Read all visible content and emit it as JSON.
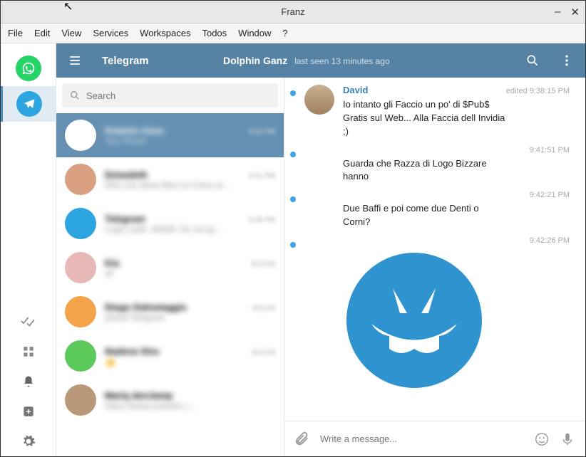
{
  "window": {
    "title": "Franz"
  },
  "menubar": [
    "File",
    "Edit",
    "View",
    "Services",
    "Workspaces",
    "Todos",
    "Window",
    "?"
  ],
  "franz_services": [
    {
      "name": "whatsapp",
      "active": false,
      "color": "#25d366"
    },
    {
      "name": "telegram",
      "active": true,
      "color": "#2ca5e0"
    }
  ],
  "telegram": {
    "brand": "Telegram",
    "peer": {
      "name": "Dolphin Ganz",
      "status": "last seen 13 minutes ago"
    },
    "search_placeholder": "Search",
    "chats": [
      {
        "name": "Dolphin Ganz",
        "preview": "You: Photo",
        "time": "9:42 PM",
        "active": true,
        "avatar_bg": "#ffffff"
      },
      {
        "name": "Dziwaleth",
        "preview": "Mira che disse Bisu la Crima st...",
        "time": "9:41 PM",
        "active": false,
        "avatar_bg": "#d8a080"
      },
      {
        "name": "Telegram",
        "preview": "Login code: 40438. Do not gi...",
        "time": "6:28 PM",
        "active": false,
        "avatar_bg": "#2ca5e0"
      },
      {
        "name": "Kia",
        "preview": "ok",
        "time": "5/12/19",
        "active": false,
        "avatar_bg": "#e8b8b8"
      },
      {
        "name": "Diego Dalnotaggio",
        "preview": "joined Telegram",
        "time": "4/11/19",
        "active": false,
        "avatar_bg": "#f5a34a"
      },
      {
        "name": "Nadene Dira",
        "preview": "👍",
        "time": "3/12/19",
        "active": false,
        "avatar_bg": "#5cc95c"
      },
      {
        "name": "Mariq denJamp",
        "preview": "https://www.youtube.c...",
        "time": "",
        "active": false,
        "avatar_bg": "#b89878"
      }
    ],
    "messages": [
      {
        "sender": "David",
        "avatar": true,
        "text": "Io intanto gli Faccio un po' di $Pub$ Gratis sul Web... Alla Faccia dell Invidia ;)",
        "time": "9:38:15 PM",
        "edited": true,
        "dot": true
      },
      {
        "sender": "",
        "avatar": false,
        "text": "Guarda che Razza di Logo Bizzare hanno",
        "time": "9:41:51 PM",
        "edited": false,
        "dot": true
      },
      {
        "sender": "",
        "avatar": false,
        "text": "Due Baffi e poi come due Denti o Corni?",
        "time": "9:42:21 PM",
        "edited": false,
        "dot": true
      },
      {
        "sender": "",
        "avatar": false,
        "text": "",
        "time": "9:42:26 PM",
        "edited": false,
        "dot": true,
        "sticker": true
      }
    ],
    "composer_placeholder": "Write a message...",
    "edited_label": "edited"
  }
}
